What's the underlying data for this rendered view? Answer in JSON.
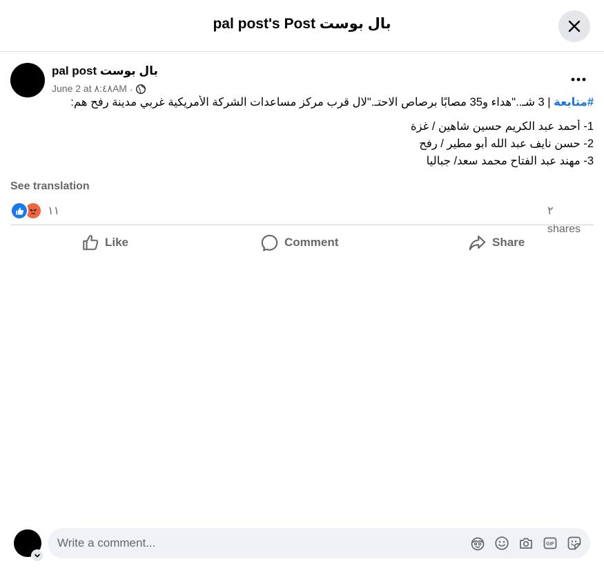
{
  "header": {
    "title": "pal post's Post بال بوست"
  },
  "post": {
    "author": "pal post بال بوست",
    "meta_time": "June 2 at ٨:٤٨AM",
    "meta_separator": "·",
    "hashtag": "#متابعة",
    "line1": " | 3 شـ..\"هداء و35 مصابًا برصاص الاحتـ.\"لال قرب مركز مساعدات الشركة الأمريكية غربي مدينة رفح هم:",
    "line2": "1- أحمد عبد الكريم حسين شاهين / غزة",
    "line3": "2- حسن نايف عبد الله أبو مطير / رفح",
    "line4": "3- مهند عبد الفتاح محمد سعد/ جباليا",
    "see_translation": "See translation"
  },
  "engagement": {
    "reactions_count": "١١",
    "shares_number": "٢",
    "shares_label": "shares"
  },
  "actions": {
    "like": "Like",
    "comment": "Comment",
    "share": "Share"
  },
  "comment_input": {
    "placeholder": "Write a comment..."
  },
  "colors": {
    "link": "#1b74e4",
    "secondary_text": "#65676b",
    "like_blue": "#1877f2",
    "angry_orange": "#f0643f",
    "input_bg": "#f0f2f5"
  },
  "icons": [
    "close-icon",
    "globe-icon",
    "more-options-icon",
    "like-reaction-icon",
    "angry-reaction-icon",
    "like-icon",
    "comment-icon",
    "share-icon",
    "avatar-sticker-icon",
    "emoji-icon",
    "camera-icon",
    "gif-icon",
    "sticker-icon",
    "chevron-down-icon"
  ]
}
